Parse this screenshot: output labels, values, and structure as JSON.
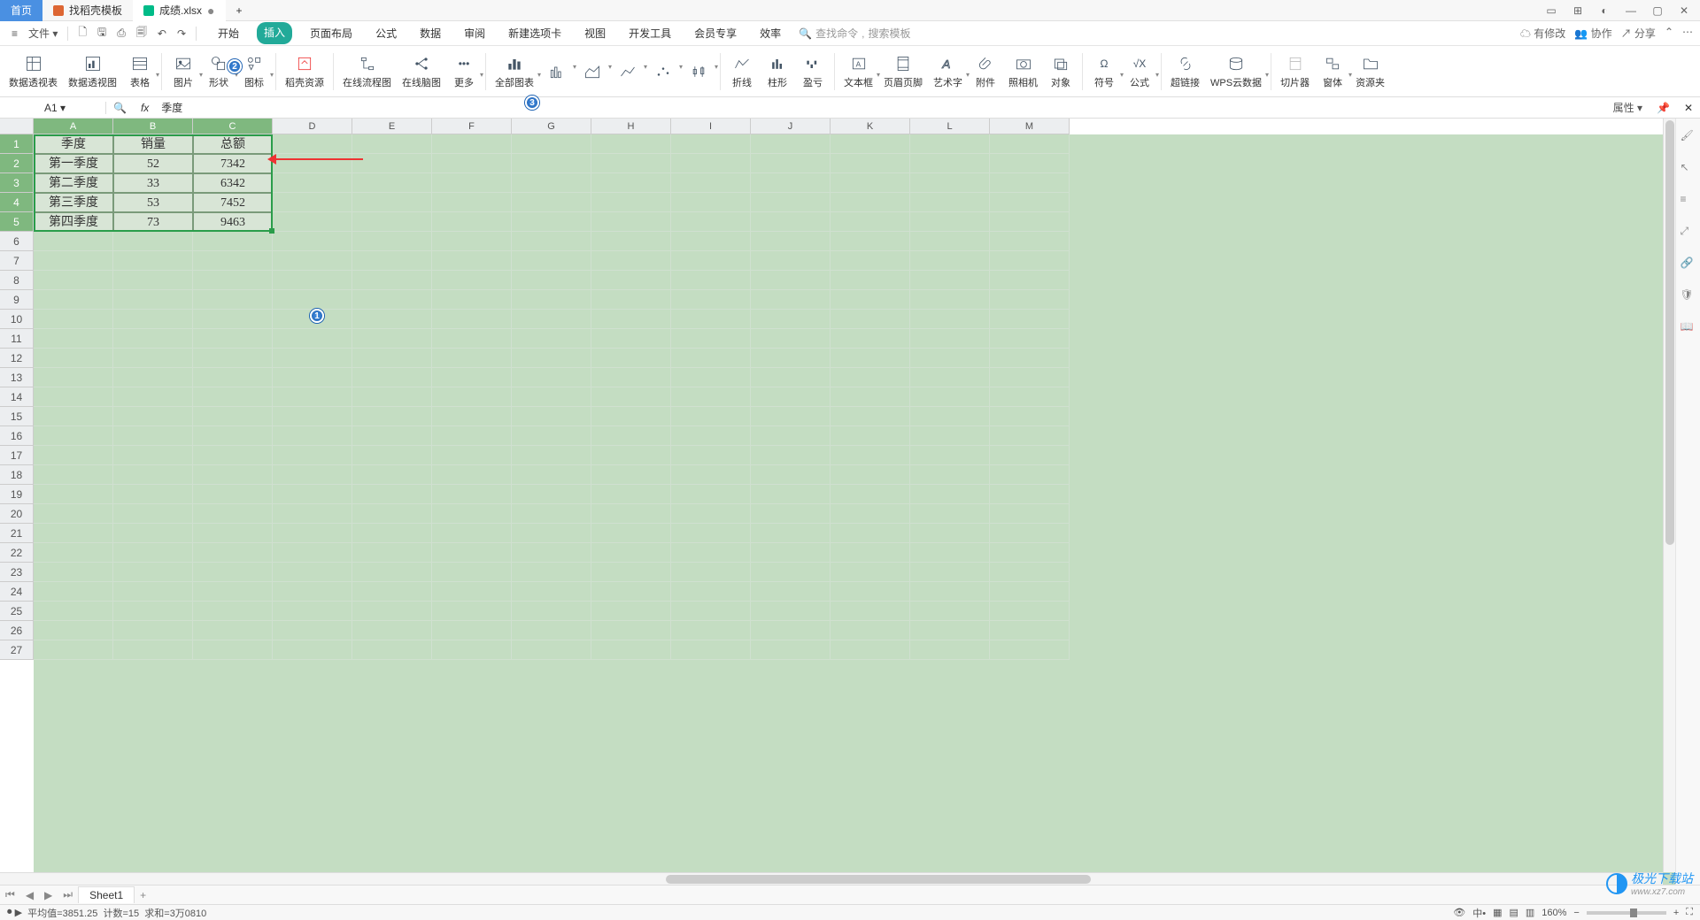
{
  "titlebar": {
    "home_tab": "首页",
    "template_tab": "找稻壳模板",
    "file_tab": "成绩.xlsx",
    "add_tab": "+"
  },
  "qat": {
    "file_menu": "文件",
    "tabs": [
      "开始",
      "插入",
      "页面布局",
      "公式",
      "数据",
      "审阅",
      "新建选项卡",
      "视图",
      "开发工具",
      "会员专享",
      "效率"
    ],
    "active_tab_index": 1,
    "search_placeholder1": "查找命令",
    "search_placeholder2": "搜索模板",
    "has_changes": "有修改",
    "collab": "协作",
    "share": "分享"
  },
  "ribbon": {
    "items": [
      {
        "label": "数据透视表"
      },
      {
        "label": "数据透视图"
      },
      {
        "label": "表格"
      },
      {
        "label": "图片"
      },
      {
        "label": "形状"
      },
      {
        "label": "图标"
      },
      {
        "label": "稻壳资源"
      },
      {
        "label": "在线流程图"
      },
      {
        "label": "在线脑图"
      },
      {
        "label": "更多"
      },
      {
        "label": "全部图表"
      },
      {
        "label": "折线"
      },
      {
        "label": "柱形"
      },
      {
        "label": "盈亏"
      },
      {
        "label": "文本框"
      },
      {
        "label": "页眉页脚"
      },
      {
        "label": "艺术字"
      },
      {
        "label": "附件"
      },
      {
        "label": "照相机"
      },
      {
        "label": "对象"
      },
      {
        "label": "符号"
      },
      {
        "label": "公式"
      },
      {
        "label": "超链接"
      },
      {
        "label": "WPS云数据"
      },
      {
        "label": "切片器"
      },
      {
        "label": "窗体"
      },
      {
        "label": "资源夹"
      }
    ]
  },
  "formula_bar": {
    "cell_ref": "A1",
    "value": "季度",
    "props": "属性"
  },
  "columns": [
    "A",
    "B",
    "C",
    "D",
    "E",
    "F",
    "G",
    "H",
    "I",
    "J",
    "K",
    "L",
    "M"
  ],
  "rows_count": 27,
  "selected_cols": 3,
  "selected_rows": 5,
  "table": {
    "headers": [
      "季度",
      "销量",
      "总额"
    ],
    "data": [
      [
        "第一季度",
        "52",
        "7342"
      ],
      [
        "第二季度",
        "33",
        "6342"
      ],
      [
        "第三季度",
        "53",
        "7452"
      ],
      [
        "第四季度",
        "73",
        "9463"
      ]
    ]
  },
  "sheet_tabs": {
    "active": "Sheet1"
  },
  "statusbar": {
    "avg": "平均值=3851.25",
    "count": "计数=15",
    "sum": "求和=3万0810",
    "zoom": "160%"
  },
  "markers": {
    "m1": "1",
    "m2": "2",
    "m3": "3"
  },
  "watermark": {
    "brand": "极光下载站",
    "url": "www.xz7.com"
  }
}
